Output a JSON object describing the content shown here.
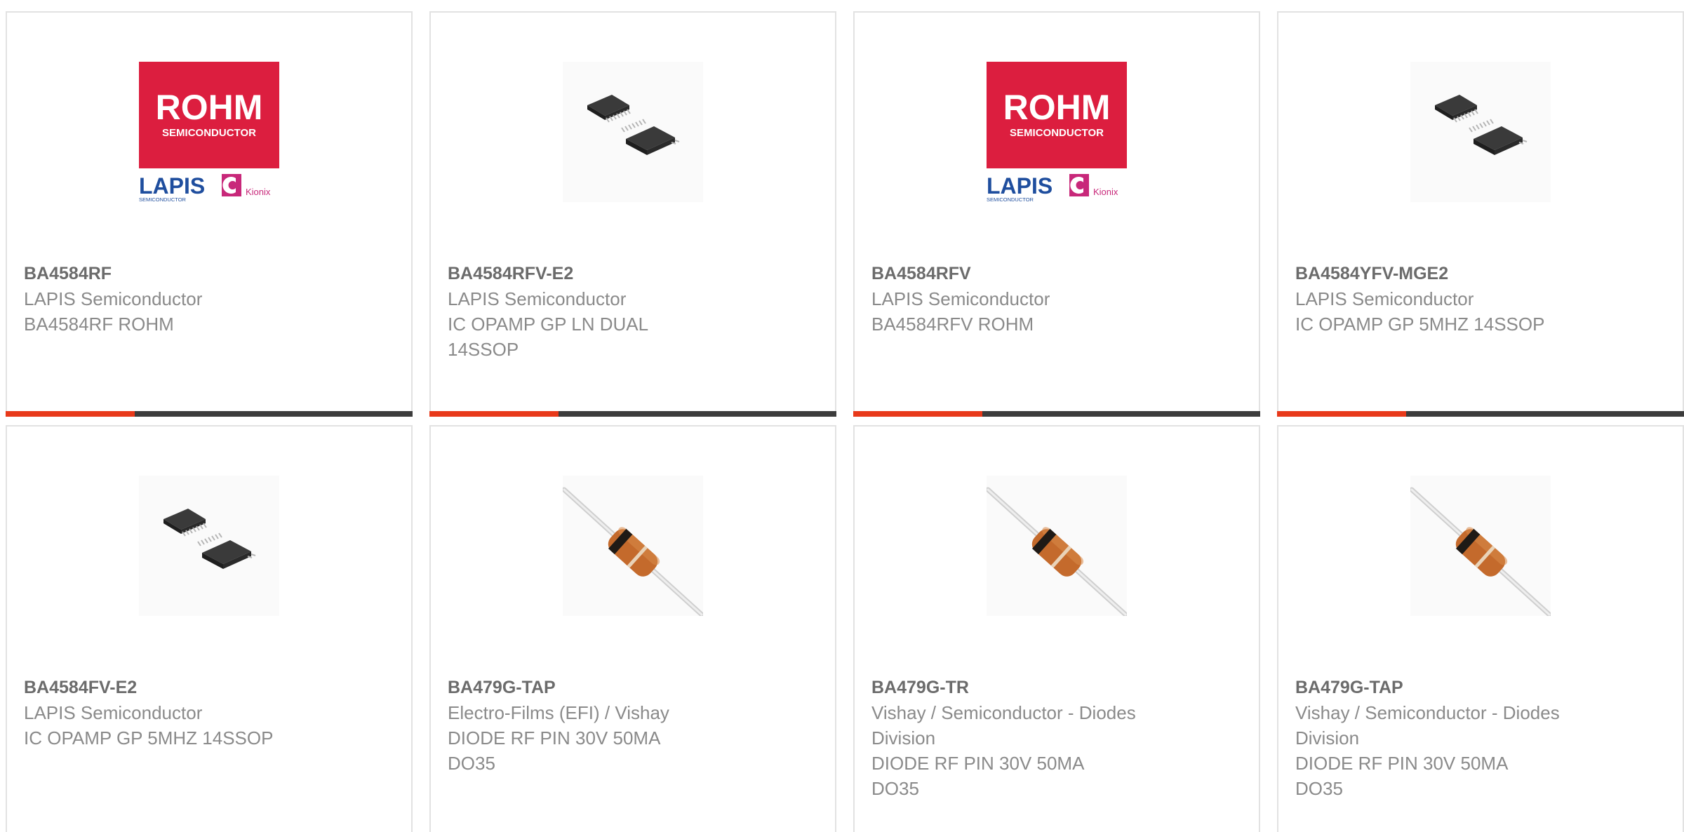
{
  "colors": {
    "accent": "#e8391a",
    "bar": "#3c3c3c",
    "rohm_red": "#dc1e3f",
    "lapis_blue": "#1f4e9e",
    "kionix_pink": "#c8287a"
  },
  "products": [
    {
      "part": "BA4584RF",
      "manufacturer": "LAPIS Semiconductor",
      "description": "BA4584RF ROHM",
      "image": "rohm-logo",
      "logo": {
        "brand": "ROHM",
        "sub": "SEMICONDUCTOR",
        "lapis": "LAPIS",
        "lapis_sub": "SEMICONDUCTOR",
        "kionix": "Kionix"
      }
    },
    {
      "part": "BA4584RFV-E2",
      "manufacturer": "LAPIS Semiconductor",
      "description": "IC OPAMP GP LN DUAL 14SSOP",
      "image": "ssop-chip-icon"
    },
    {
      "part": "BA4584RFV",
      "manufacturer": "LAPIS Semiconductor",
      "description": "BA4584RFV ROHM",
      "image": "rohm-logo",
      "logo": {
        "brand": "ROHM",
        "sub": "SEMICONDUCTOR",
        "lapis": "LAPIS",
        "lapis_sub": "SEMICONDUCTOR",
        "kionix": "Kionix"
      }
    },
    {
      "part": "BA4584YFV-MGE2",
      "manufacturer": "LAPIS Semiconductor",
      "description": "IC OPAMP GP 5MHZ 14SSOP",
      "image": "ssop-chip-icon"
    },
    {
      "part": "BA4584FV-E2",
      "manufacturer": "LAPIS Semiconductor",
      "description": "IC OPAMP GP 5MHZ 14SSOP",
      "image": "ssop-chip-icon"
    },
    {
      "part": "BA479G-TAP",
      "manufacturer": "Electro-Films (EFI) / Vishay",
      "description": "DIODE RF PIN 30V 50MA DO35",
      "image": "axial-diode-icon"
    },
    {
      "part": "BA479G-TR",
      "manufacturer": "Vishay / Semiconductor - Diodes Division",
      "description": "DIODE RF PIN 30V 50MA DO35",
      "image": "axial-diode-icon"
    },
    {
      "part": "BA479G-TAP",
      "manufacturer": "Vishay / Semiconductor - Diodes Division",
      "description": "DIODE RF PIN 30V 50MA DO35",
      "image": "axial-diode-icon"
    }
  ]
}
